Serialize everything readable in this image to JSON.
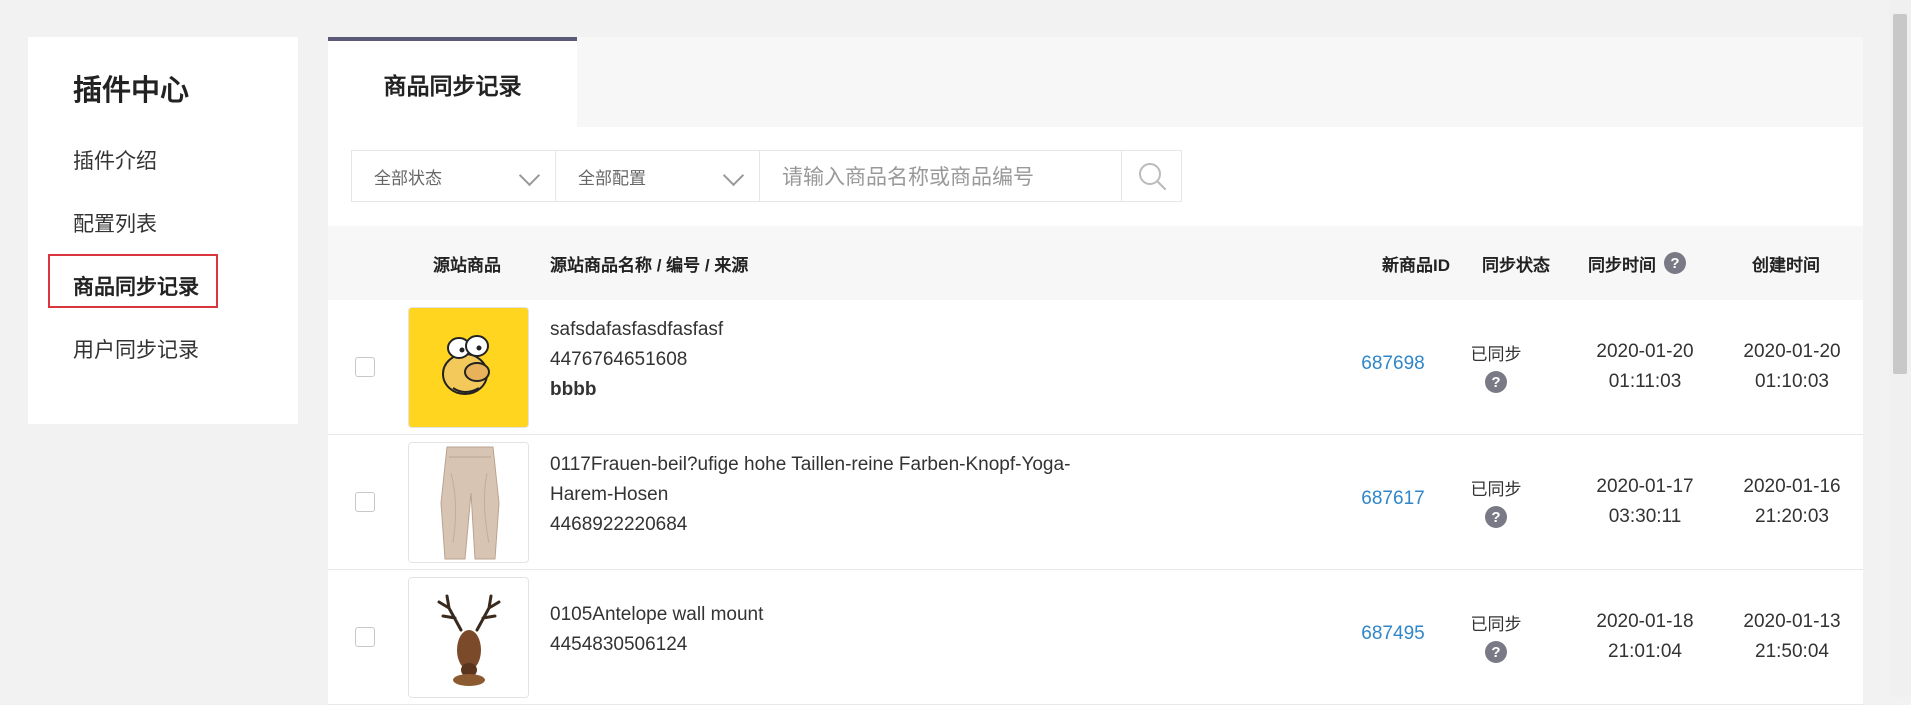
{
  "sidebar": {
    "title": "插件中心",
    "items": [
      {
        "label": "插件介绍"
      },
      {
        "label": "配置列表"
      },
      {
        "label": "商品同步记录"
      },
      {
        "label": "用户同步记录"
      }
    ]
  },
  "tabs": [
    {
      "label": "商品同步记录"
    }
  ],
  "filters": {
    "status": "全部状态",
    "config": "全部配置",
    "search_placeholder": "请输入商品名称或商品编号"
  },
  "table": {
    "headers": {
      "source_product": "源站商品",
      "name_code_source": "源站商品名称 / 编号 / 来源",
      "new_id": "新商品ID",
      "sync_status": "同步状态",
      "sync_time": "同步时间",
      "created_time": "创建时间"
    },
    "help_glyph": "?",
    "rows": [
      {
        "name": "safsdafasfasdfasfasf",
        "code": "4476764651608",
        "source": "bbbb",
        "new_id": "687698",
        "status": "已同步",
        "sync_date": "2020-01-20",
        "sync_clock": "01:11:03",
        "created_date": "2020-01-20",
        "created_clock": "01:10:03",
        "thumb_icon": "cartoon-face-icon"
      },
      {
        "name_line1": "0117Frauen-beil?ufige hohe Taillen-reine Farben-Knopf-Yoga-",
        "name_line2": "Harem-Hosen",
        "code": "4468922220684",
        "new_id": "687617",
        "status": "已同步",
        "sync_date": "2020-01-17",
        "sync_clock": "03:30:11",
        "created_date": "2020-01-16",
        "created_clock": "21:20:03",
        "thumb_icon": "pants-icon"
      },
      {
        "name": "0105Antelope wall mount",
        "code": "4454830506124",
        "new_id": "687495",
        "status": "已同步",
        "sync_date": "2020-01-18",
        "sync_clock": "21:01:04",
        "created_date": "2020-01-13",
        "created_clock": "21:50:04",
        "thumb_icon": "antelope-head-icon"
      }
    ]
  },
  "colors": {
    "accent_link": "#2f86c9",
    "active_border": "#d9363e",
    "tab_top": "#5a5a78"
  }
}
